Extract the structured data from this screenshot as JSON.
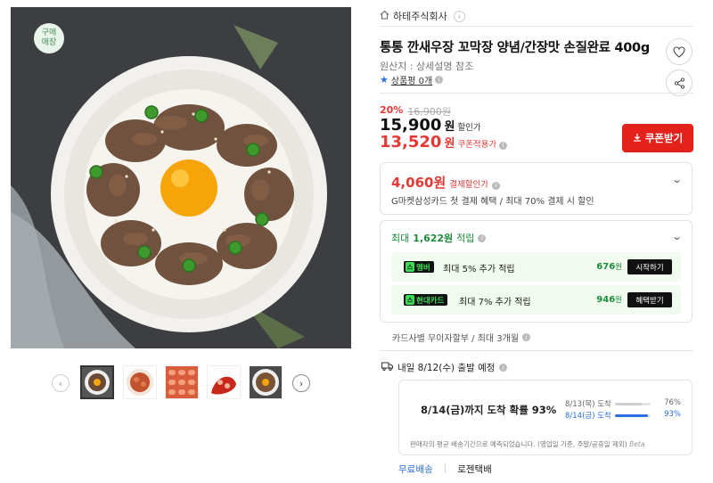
{
  "hero": {
    "badge": "구매\n매장",
    "alt": "food-bowl-photo"
  },
  "thumbnails": [
    {
      "name": "thumb-bowl-top"
    },
    {
      "name": "thumb-shrimp-plate"
    },
    {
      "name": "thumb-shrimp-rows"
    },
    {
      "name": "thumb-spicy-shrimp"
    },
    {
      "name": "thumb-bowl-egg"
    }
  ],
  "seller": {
    "name": "하테주식회사"
  },
  "product": {
    "title": "통통 깐새우장 꼬막장 양념/간장맛 손질완료 400g",
    "origin": "원산지 : 상세설명 참조",
    "review_label": "상품평 0개"
  },
  "price": {
    "discount_rate": "20%",
    "original": "16,900원",
    "sale": "15,900",
    "sale_unit": "원",
    "sale_tag": "할인가",
    "coupon_price": "13,520",
    "coupon_unit": "원",
    "coupon_tag": "쿠폰적용가"
  },
  "coupon_button": {
    "label": "쿠폰받기"
  },
  "payment_benefit": {
    "amount": "4,060원",
    "tag": "결제할인가",
    "desc": "G마켓삼성카드 첫 결제 혜택 / 최대 70% 결제 시 할인"
  },
  "points": {
    "head_prefix": "최대",
    "head_amount": "1,622원",
    "head_suffix": "적립",
    "rows": [
      {
        "badge": "멤버",
        "text": "최대 5% 추가 적립",
        "amount": "676",
        "unit": "원",
        "action": "시작하기"
      },
      {
        "badge": "현대카드",
        "text": "최대 7% 추가 적립",
        "amount": "946",
        "unit": "원",
        "action": "혜택받기"
      }
    ]
  },
  "installment": {
    "text": "카드사별 무이자할부 / 최대 3개월"
  },
  "shipping": {
    "headline": "내일 8/12(수) 출발 예정",
    "probability": "8/14(금)까지 도착 확률 93%",
    "bars": [
      {
        "date": "8/13(목) 도착",
        "pct": "76%",
        "value": 0.76
      },
      {
        "date": "8/14(금) 도착",
        "pct": "93%",
        "value": 0.93
      }
    ],
    "note": "판매자의 평균 배송기간으로 예측되었습니다. (영업일 기준, 주말/공휴일 제외)",
    "beta": "Beta",
    "free_label": "무료배송",
    "carrier": "로젠택배"
  },
  "colors": {
    "accent_red": "#e3221c",
    "price_red": "#e53935",
    "green": "#1b8c3b",
    "blue": "#2b6fe0"
  },
  "icons": {
    "heart": "heart-icon",
    "share": "share-icon",
    "home": "home-icon",
    "truck": "truck-icon"
  }
}
